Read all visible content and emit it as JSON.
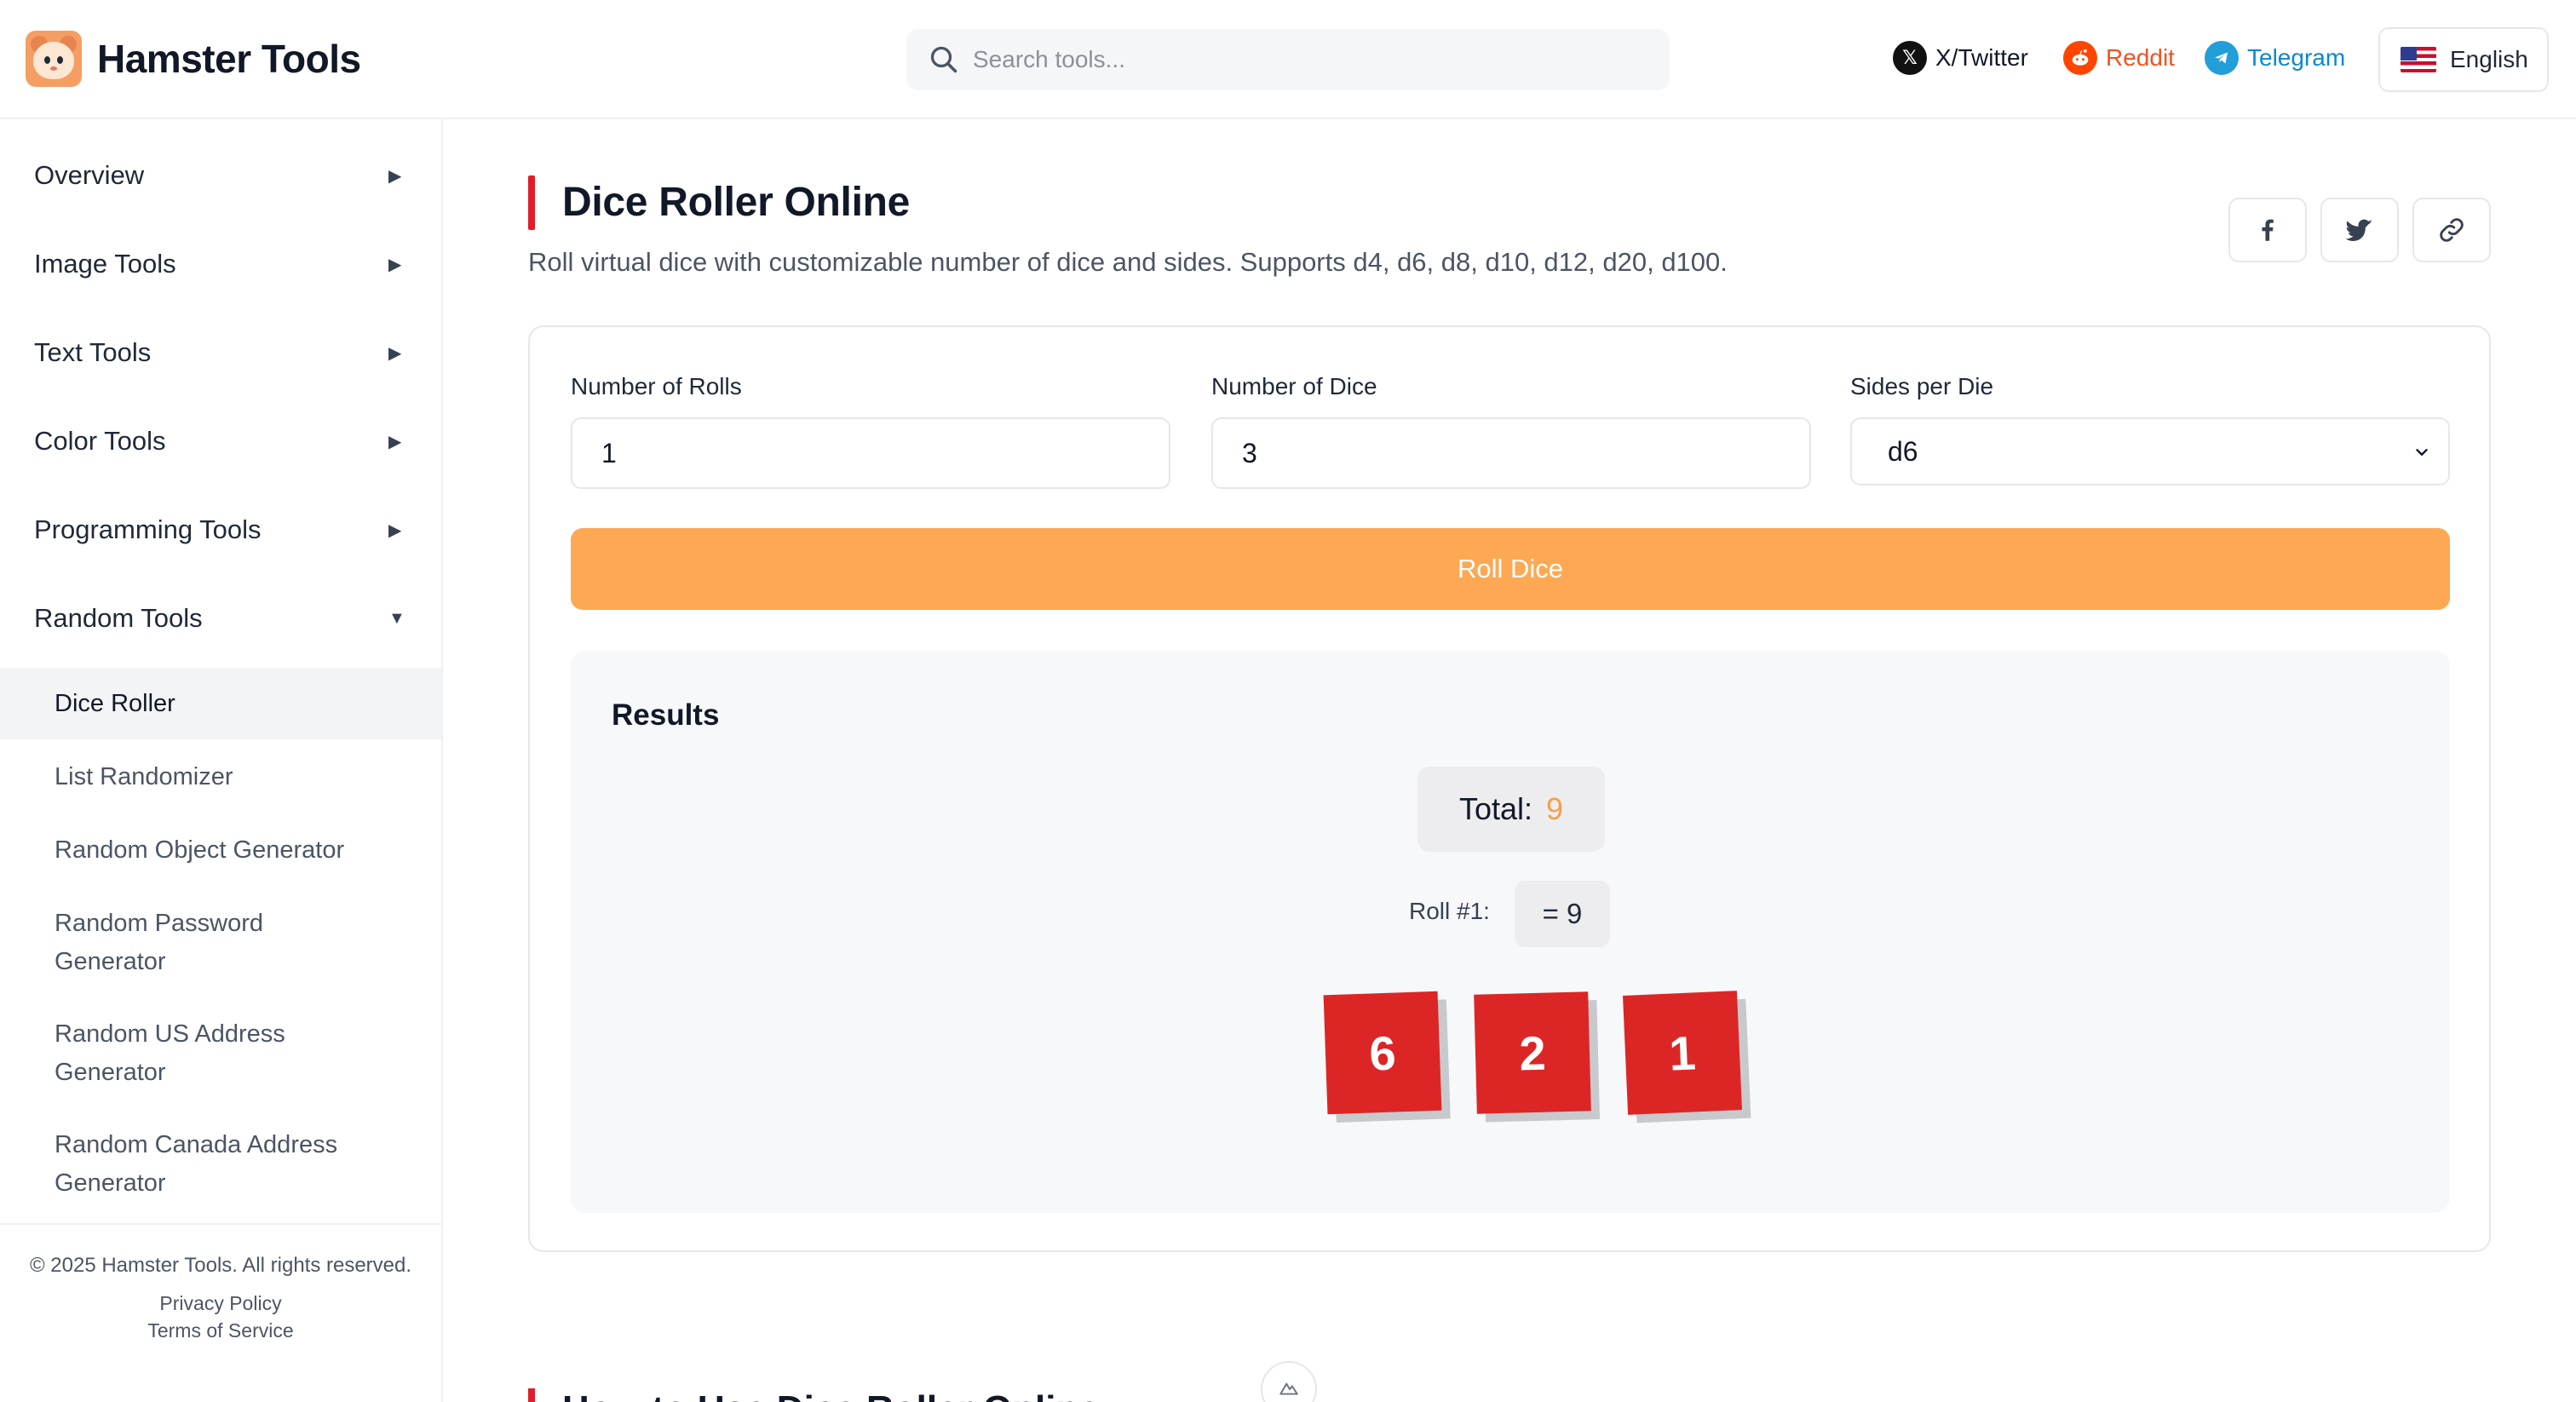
{
  "header": {
    "brand_name": "Hamster Tools",
    "search_placeholder": "Search tools...",
    "social": [
      {
        "label": "X/Twitter",
        "icon": "x-logo-icon",
        "color": "#111111"
      },
      {
        "label": "Reddit",
        "icon": "reddit-icon",
        "color": "#ff4500"
      },
      {
        "label": "Telegram",
        "icon": "telegram-icon",
        "color": "#229ed9"
      }
    ],
    "language": "English",
    "language_flag": "us-flag-icon"
  },
  "sidebar": {
    "groups": [
      {
        "label": "Overview",
        "arrow": "▶"
      },
      {
        "label": "Image Tools",
        "arrow": "▶"
      },
      {
        "label": "Text Tools",
        "arrow": "▶"
      },
      {
        "label": "Color Tools",
        "arrow": "▶"
      },
      {
        "label": "Programming Tools",
        "arrow": "▶"
      },
      {
        "label": "Random Tools",
        "arrow": "▼"
      }
    ],
    "sub_items": [
      {
        "label": "Dice Roller",
        "active": true
      },
      {
        "label": "List Randomizer"
      },
      {
        "label": "Random Object Generator"
      },
      {
        "label": "Random Password Generator"
      },
      {
        "label": "Random US Address Generator"
      },
      {
        "label": "Random Canada Address Generator"
      }
    ],
    "footer": {
      "copyright": "© 2025 Hamster Tools. All rights reserved.",
      "privacy": "Privacy Policy",
      "terms": "Terms of Service"
    }
  },
  "main": {
    "title": "Dice Roller Online",
    "subtitle": "Roll virtual dice with customizable number of dice and sides. Supports d4, d6, d8, d10, d12, d20, d100.",
    "share": [
      "facebook-icon",
      "twitter-icon",
      "link-icon"
    ],
    "form": {
      "rolls_label": "Number of Rolls",
      "rolls_value": "1",
      "dice_label": "Number of Dice",
      "dice_value": "3",
      "sides_label": "Sides per Die",
      "sides_value": "d6",
      "roll_button": "Roll Dice"
    },
    "results": {
      "title": "Results",
      "total_label": "Total:",
      "total_value": "9",
      "roll_label": "Roll #1:",
      "roll_sum": "= 9",
      "dice": [
        "6",
        "2",
        "1"
      ]
    },
    "next_heading": "How to Use Dice Roller Online"
  },
  "colors": {
    "accent_red": "#e11d2a",
    "die_red": "#dc2626",
    "button_orange": "#fda953",
    "total_orange": "#f59e4a"
  }
}
